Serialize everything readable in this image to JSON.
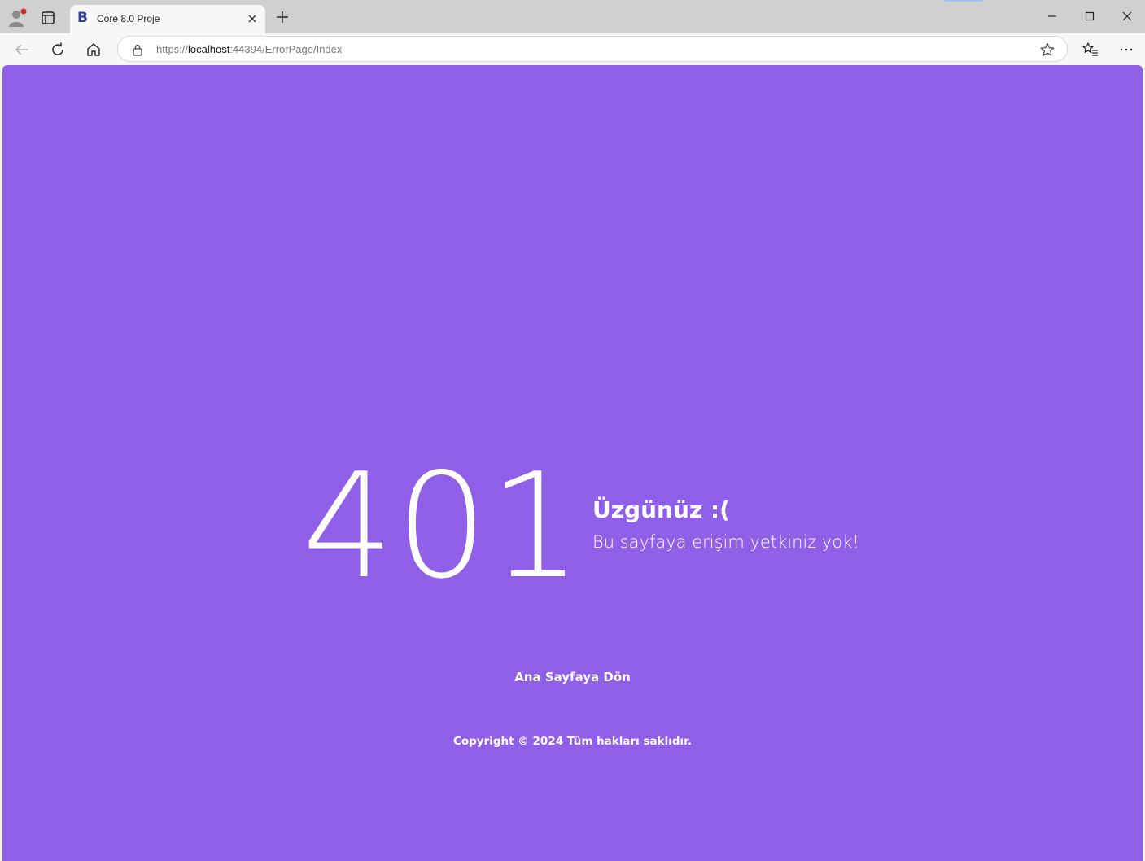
{
  "browser": {
    "tab": {
      "favicon_letter": "B",
      "title": "Core 8.0 Proje"
    },
    "address": {
      "protocol": "https://",
      "host": "localhost",
      "rest": ":44394/ErrorPage/Index"
    },
    "icons": {
      "profile": "profile-icon",
      "workspaces": "workspaces-icon",
      "tab_close": "close-icon",
      "new_tab": "plus-icon",
      "minimize": "minimize-icon",
      "maximize": "maximize-icon",
      "close_window": "close-icon",
      "back": "back-arrow-icon",
      "refresh": "refresh-icon",
      "home": "home-icon",
      "lock": "lock-icon",
      "favorite": "star-icon",
      "favorites_list": "favorites-icon",
      "more": "ellipsis-icon"
    }
  },
  "page": {
    "background_color": "#8f5fe8",
    "error_code": "401",
    "heading": "Üzgünüz :(",
    "message": "Bu sayfaya erişim yetkiniz yok!",
    "home_link": "Ana Sayfaya Dön",
    "copyright": "Copyright © 2024 Tüm hakları saklıdır."
  }
}
